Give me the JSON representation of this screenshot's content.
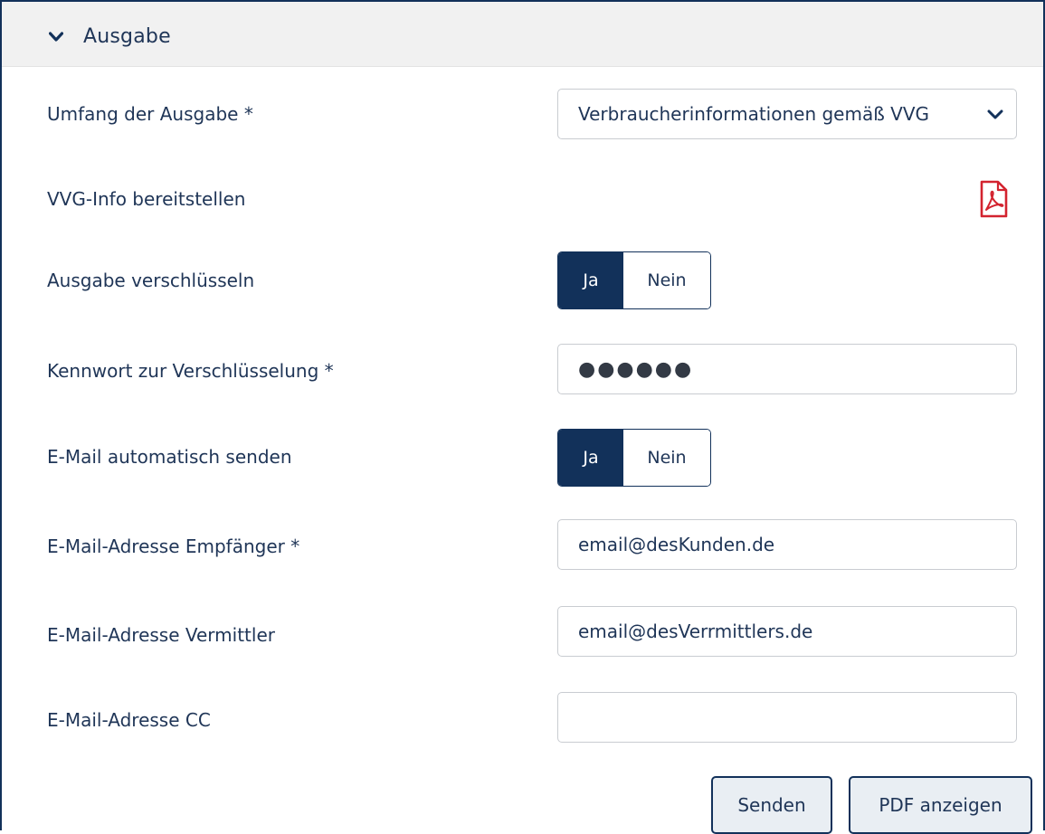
{
  "section": {
    "title": "Ausgabe",
    "collapse_icon": "chevron-down-icon"
  },
  "rows": {
    "umfang": {
      "label": "Umfang der Ausgabe *",
      "value": "Verbraucherinformationen gemäß VVG"
    },
    "vvg_info": {
      "label": "VVG-Info bereitstellen",
      "icon": "pdf-file-icon"
    },
    "encrypt": {
      "label": "Ausgabe verschlüsseln",
      "yes": "Ja",
      "no": "Nein",
      "selected": "Ja"
    },
    "password": {
      "label": "Kennwort zur Verschlüsselung *",
      "value": "●●●●●●"
    },
    "auto_email": {
      "label": "E-Mail automatisch senden",
      "yes": "Ja",
      "no": "Nein",
      "selected": "Ja"
    },
    "email_recipient": {
      "label": "E-Mail-Adresse Empfänger *",
      "value": "email@desKunden.de"
    },
    "email_broker": {
      "label": "E-Mail-Adresse Vermittler",
      "value": "email@desVerrmittlers.de"
    },
    "email_cc": {
      "label": "E-Mail-Adresse CC",
      "value": ""
    }
  },
  "actions": {
    "send": "Senden",
    "show_pdf": "PDF anzeigen"
  },
  "colors": {
    "primary": "#12315a",
    "text": "#1f3557",
    "header_bg": "#f1f1f1",
    "pdf_red": "#d3232f",
    "button_bg": "#e9eef3"
  }
}
